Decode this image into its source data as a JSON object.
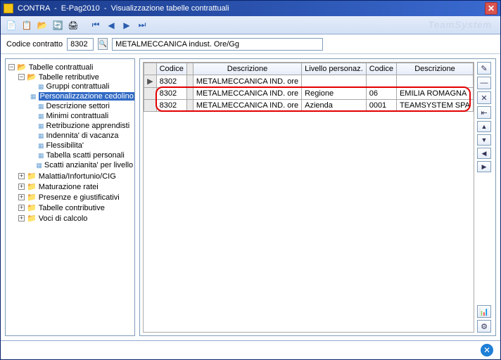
{
  "title": "CONTRA  -  E-Pag2010  -  Visualizzazione tabelle contrattuali",
  "brand": "TeamSystem",
  "codebar": {
    "label": "Codice contratto",
    "code": "8302",
    "desc": "METALMECCANICA indust. Ore/Gg"
  },
  "tree": {
    "root": "Tabelle contrattuali",
    "n_retri": "Tabelle retributive",
    "leaves": [
      "Gruppi contrattuali",
      "Personalizzazione cedolino",
      "Descrizione settori",
      "Minimi contrattuali",
      "Retribuzione apprendisti",
      "Indennita' di vacanza",
      "Flessibilita'",
      "Tabella scatti personali",
      "Scatti anzianita' per livello"
    ],
    "closed": [
      "Malattia/Infortunio/CIG",
      "Maturazione ratei",
      "Presenze e giustificativi",
      "Tabelle contributive",
      "Voci di calcolo"
    ]
  },
  "grid": {
    "headers": [
      "Codice",
      "Descrizione",
      "Livello personaz.",
      "Codice",
      "Descrizione"
    ],
    "rows": [
      {
        "c0": "8302",
        "c1": "METALMECCANICA IND. ore",
        "c2": "",
        "c3": "",
        "c4": ""
      },
      {
        "c0": "8302",
        "c1": "METALMECCANICA IND. ore",
        "c2": "Regione",
        "c3": "06",
        "c4": "EMILIA ROMAGNA"
      },
      {
        "c0": "8302",
        "c1": "METALMECCANICA IND. ore",
        "c2": "Azienda",
        "c3": "0001",
        "c4": "TEAMSYSTEM SPA"
      }
    ]
  }
}
